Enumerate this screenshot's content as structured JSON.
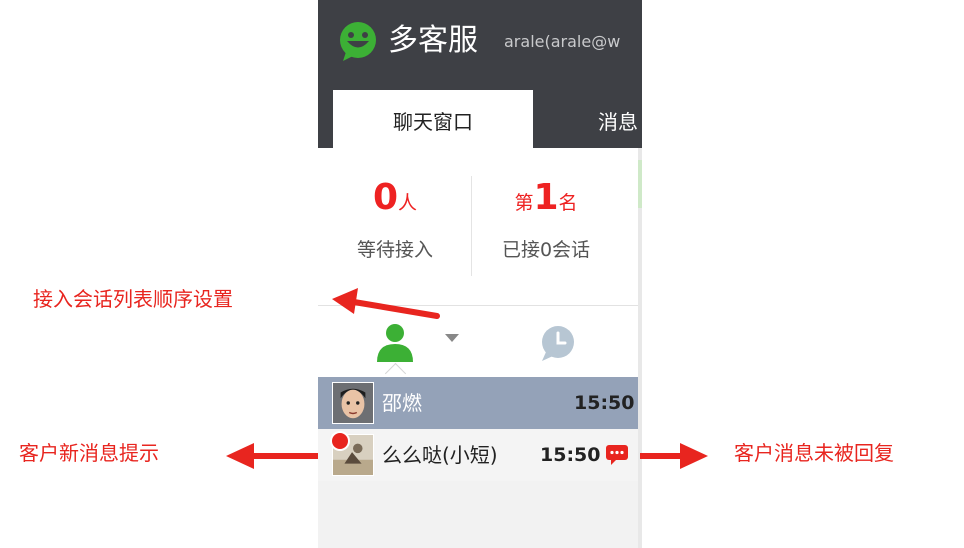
{
  "app": {
    "title": "多客服",
    "account": "arale(arale@w",
    "colors": {
      "header": "#3e4045",
      "accent_green": "#3cb035",
      "alert_red": "#e8251f"
    }
  },
  "tabs": [
    {
      "label": "聊天窗口",
      "selected": true
    },
    {
      "label": "消息",
      "selected": false
    }
  ],
  "stats": {
    "waiting": {
      "number": "0",
      "unit": "人",
      "label": "等待接入"
    },
    "rank": {
      "prefix": "第",
      "number": "1",
      "unit": "名",
      "label": "已接0会话"
    }
  },
  "toolbar": {
    "icons": [
      "person-icon",
      "chevron-down-icon",
      "clock-icon"
    ]
  },
  "sessions": [
    {
      "name": "邵燃",
      "time": "15:50",
      "selected": true,
      "new_message": false,
      "unreplied": false
    },
    {
      "name": "么么哒(小短)",
      "time": "15:50",
      "selected": false,
      "new_message": true,
      "unreplied": true
    }
  ],
  "annotations": {
    "sort_setting": "接入会话列表顺序设置",
    "new_message": "客户新消息提示",
    "unreplied": "客户消息未被回复"
  }
}
